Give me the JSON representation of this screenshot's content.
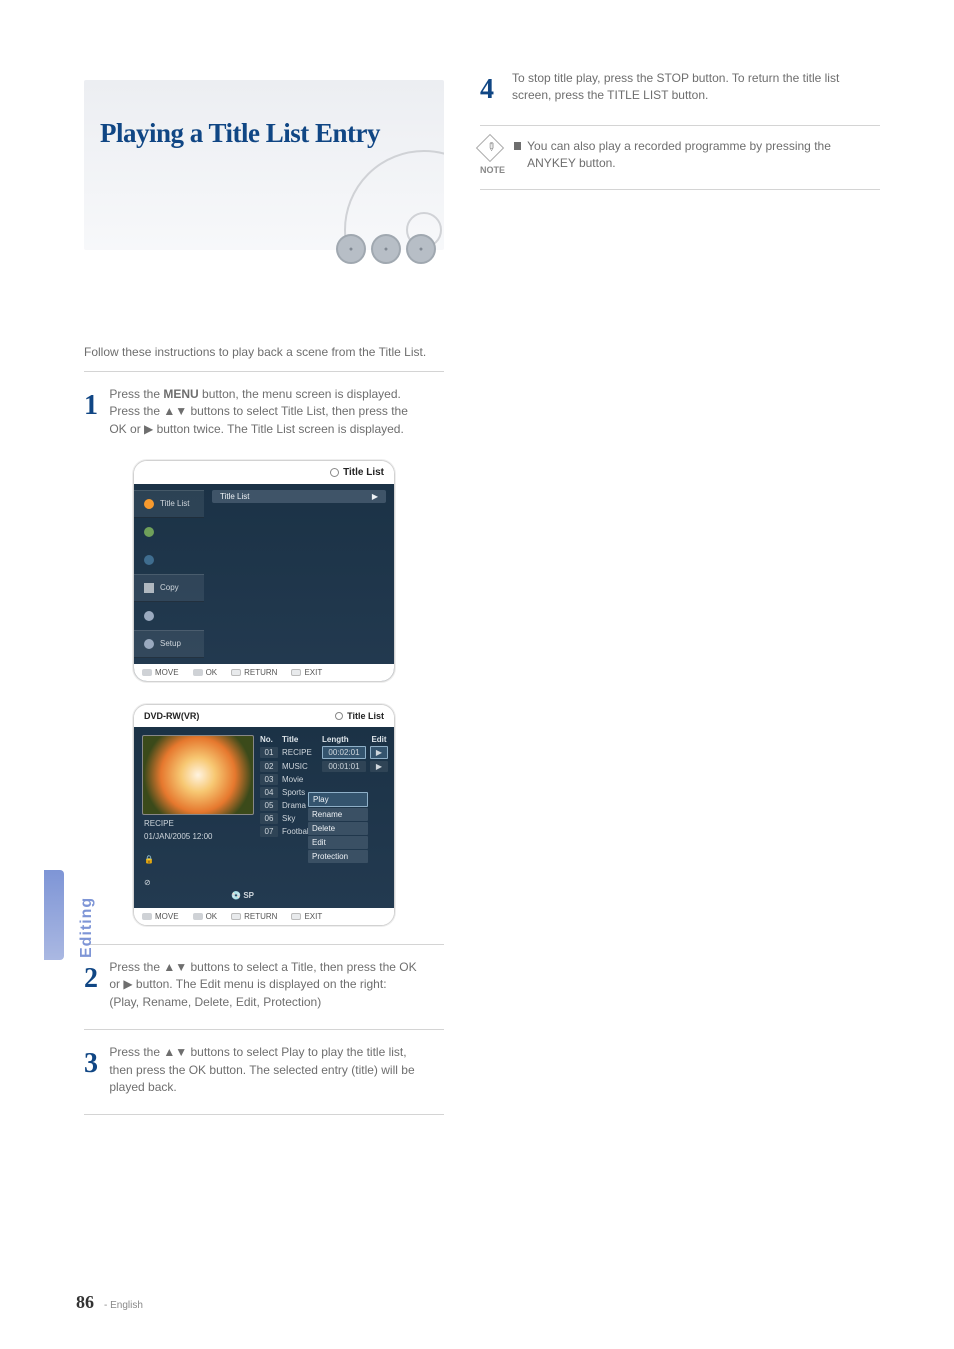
{
  "heading": "Playing a Title List Entry",
  "intro": "Follow these instructions to play back a scene from the Title List.",
  "step1": {
    "lead": "Press the ",
    "bold": "MENU",
    "tail": " button, the menu screen is displayed. Press the ▲▼ buttons to select Title List, then press the OK or ▶ button twice. The Title List screen is displayed."
  },
  "step2": {
    "lead": "Press the ",
    "arrows": "▲▼",
    "mid": " buttons to select a Title, then press the OK or ",
    "play": "▶",
    "tail": " button. The Edit menu is displayed on the right: (Play, Rename, Delete, Edit, Protection)"
  },
  "step3": {
    "lead": "Press the ",
    "arrows": "▲▼",
    "mid": " buttons to select Play to play the title list, then press the OK button. The selected entry (title) will be played back."
  },
  "step4": {
    "lead": "To stop title play, press the STOP button. To return the title list screen, press the TITLE LIST button."
  },
  "noteLabel": "NOTE",
  "note": {
    "text": "You can also play a recorded programme by pressing the ANYKEY button."
  },
  "osd1": {
    "headerRight": "Title List",
    "sidebar": [
      "Title List",
      "",
      "",
      "Copy",
      "",
      "Setup"
    ],
    "chip": "Title List",
    "bottom": [
      "MOVE",
      "OK",
      "RETURN",
      "EXIT"
    ]
  },
  "osd2": {
    "hLeft": "DVD-RW(VR)",
    "hRight": "Title List",
    "thumbTitle": "RECIPE",
    "thumbDate": "01/JAN/2005 12:00",
    "sp": "SP",
    "cols": {
      "no": "No.",
      "title": "Title",
      "len": "Length",
      "edit": "Edit"
    },
    "rows": [
      {
        "no": "01",
        "title": "RECIPE",
        "len": "00:02:01"
      },
      {
        "no": "02",
        "title": "MUSIC",
        "len": "00:01:01"
      },
      {
        "no": "03",
        "title": "Movie",
        "len": ""
      },
      {
        "no": "04",
        "title": "Sports",
        "len": ""
      },
      {
        "no": "05",
        "title": "Drama",
        "len": ""
      },
      {
        "no": "06",
        "title": "Sky",
        "len": ""
      },
      {
        "no": "07",
        "title": "Football",
        "len": ""
      }
    ],
    "popup": [
      "Play",
      "Rename",
      "Delete",
      "Edit",
      "Protection"
    ],
    "bottom": [
      "MOVE",
      "OK",
      "RETURN",
      "EXIT"
    ]
  },
  "sideTab": "Editing",
  "pageNumber": "86",
  "footer": "- English"
}
